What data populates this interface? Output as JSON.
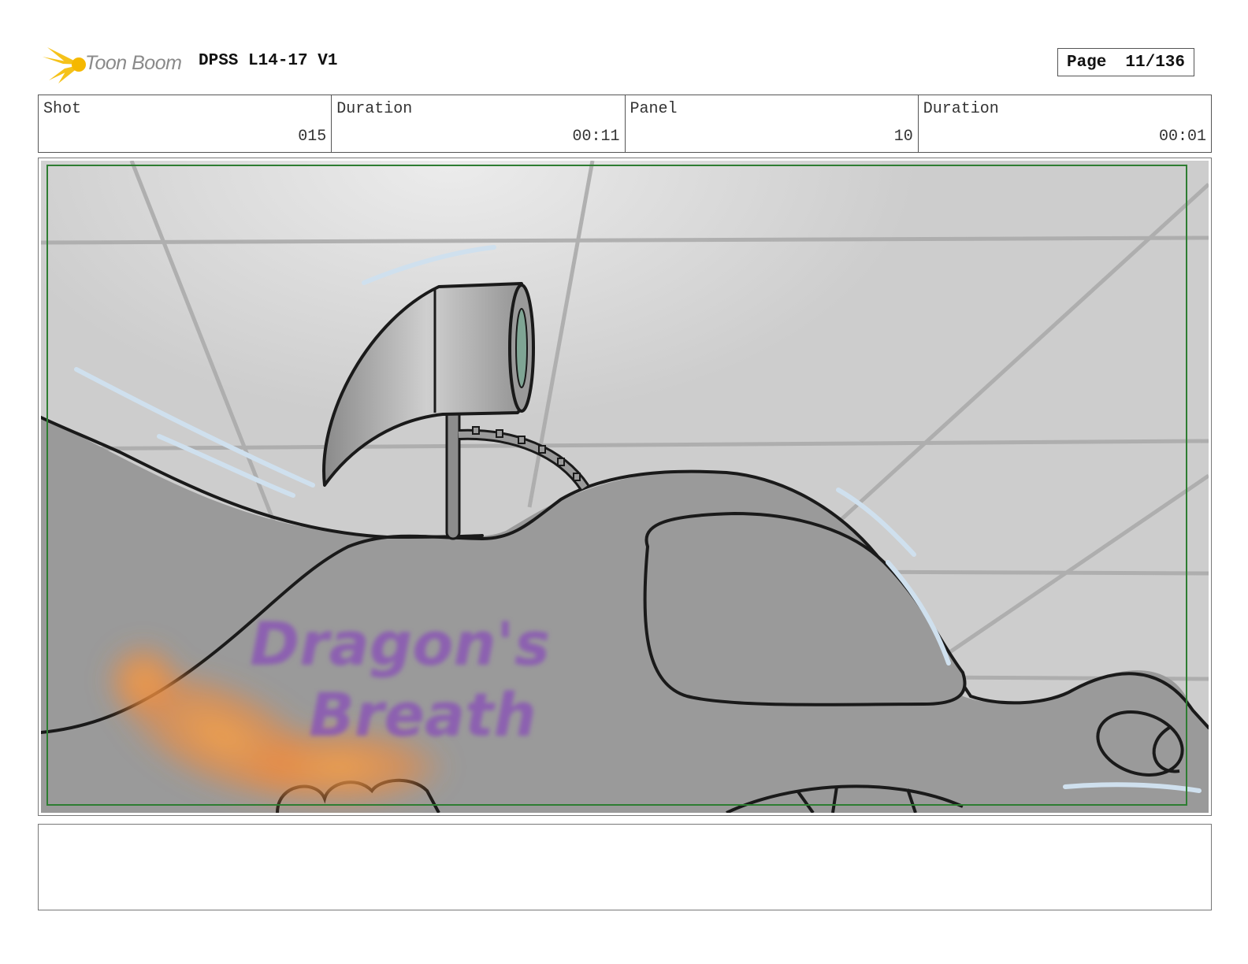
{
  "header": {
    "logo_text": "Toon Boom",
    "project_title": "DPSS L14-17 V1",
    "page_label": "Page",
    "page_value": "11/136"
  },
  "info": [
    {
      "label": "Shot",
      "value": "015"
    },
    {
      "label": "Duration",
      "value": "00:11"
    },
    {
      "label": "Panel",
      "value": "10"
    },
    {
      "label": "Duration",
      "value": "00:01"
    }
  ],
  "panel": {
    "sketch_lettering": "Dragon's Breath"
  },
  "notes": {
    "text": ""
  },
  "colors": {
    "logo_yellow": "#f5c21a",
    "safe_frame": "#2e7d32",
    "wall": "#cdcdcd",
    "dragon_body": "#9a9a9a",
    "lettering": "#8a55b5",
    "flame": "#f08a3c"
  }
}
